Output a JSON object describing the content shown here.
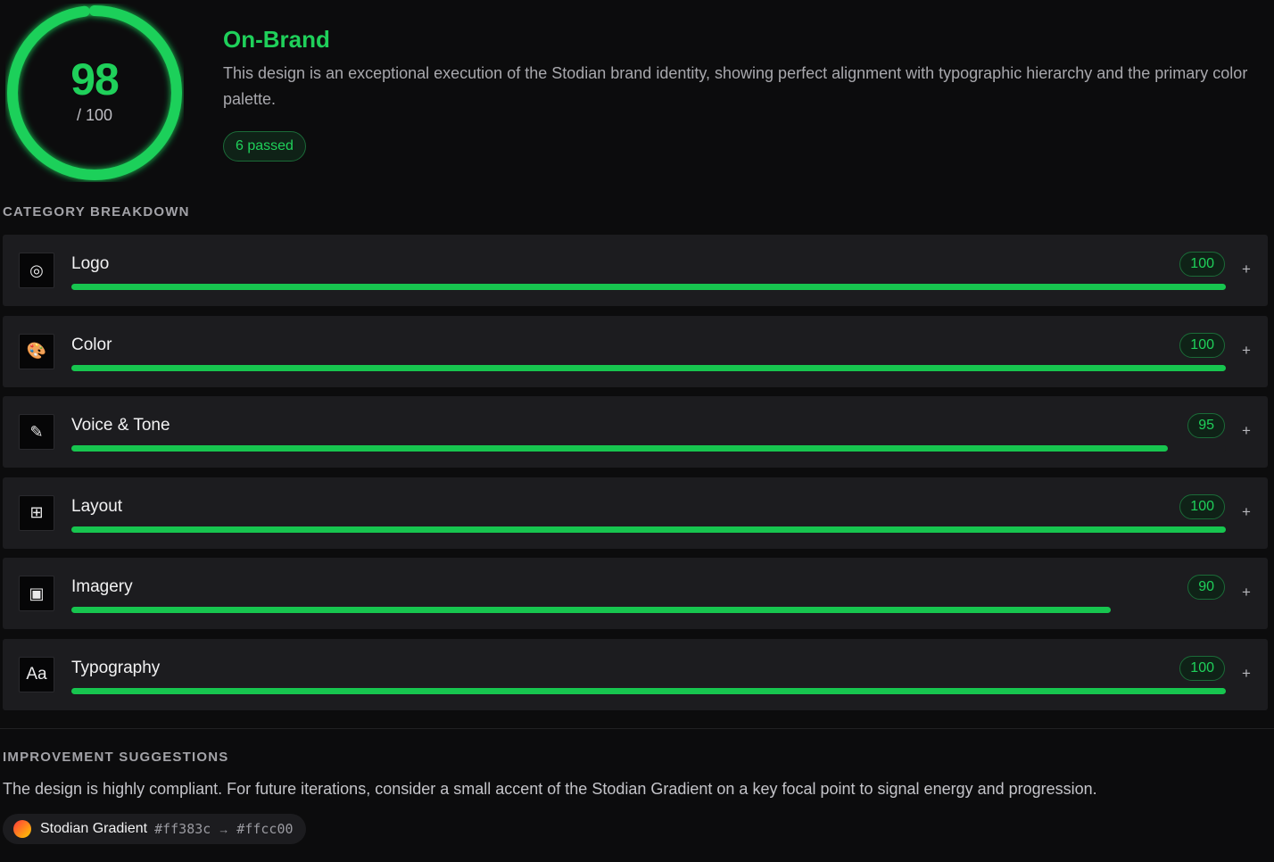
{
  "score": {
    "value": "98",
    "max_label": "/ 100",
    "fraction": 0.98,
    "color": "#1fd05a"
  },
  "header": {
    "verdict": "On-Brand",
    "summary": "This design is an exceptional execution of the Stodian brand identity, showing perfect alignment with typographic hierarchy and the primary color palette.",
    "passed_badge": "6 passed"
  },
  "breakdown": {
    "heading": "CATEGORY BREAKDOWN",
    "categories": [
      {
        "name": "Logo",
        "score": "100",
        "fraction": 1.0,
        "icon": "target-icon",
        "glyph": "◎",
        "expand": "+"
      },
      {
        "name": "Color",
        "score": "100",
        "fraction": 1.0,
        "icon": "palette-icon",
        "glyph": "🎨",
        "expand": "+"
      },
      {
        "name": "Voice & Tone",
        "score": "95",
        "fraction": 0.95,
        "icon": "pencil-icon",
        "glyph": "✎",
        "expand": "+"
      },
      {
        "name": "Layout",
        "score": "100",
        "fraction": 1.0,
        "icon": "grid-icon",
        "glyph": "⊞",
        "expand": "+"
      },
      {
        "name": "Imagery",
        "score": "90",
        "fraction": 0.9,
        "icon": "image-icon",
        "glyph": "▣",
        "expand": "+"
      },
      {
        "name": "Typography",
        "score": "100",
        "fraction": 1.0,
        "icon": "typography-icon",
        "glyph": "Aa",
        "expand": "+"
      }
    ]
  },
  "suggestions": {
    "heading": "IMPROVEMENT SUGGESTIONS",
    "text": "The design is highly compliant. For future iterations, consider a small accent of the Stodian Gradient on a key focal point to signal energy and progression.",
    "gradient_chip": {
      "name": "Stodian Gradient",
      "from": "#ff383c",
      "arrow": "→",
      "to": "#ffcc00"
    }
  },
  "colors": {
    "accent": "#1fd05a",
    "bar": "#17c54f",
    "background": "#0c0c0d",
    "card": "#1c1c1f"
  }
}
